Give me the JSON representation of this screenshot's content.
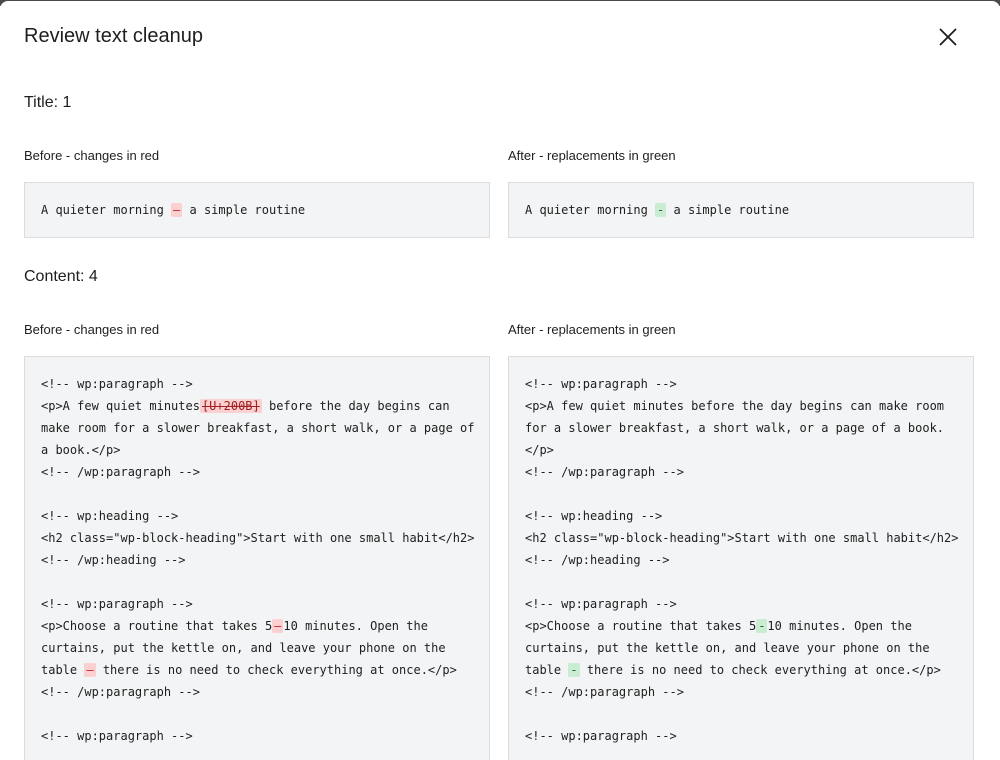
{
  "modal": {
    "title": "Review text cleanup",
    "close_icon": "close-icon"
  },
  "title_section": {
    "heading": "Title: 1",
    "before_label": "Before - changes in red",
    "after_label": "After - replacements in green",
    "before": {
      "pre": "A quieter morning ",
      "mark": "—",
      "post": " a simple routine"
    },
    "after": {
      "pre": "A quieter morning ",
      "mark": "-",
      "post": " a simple routine"
    }
  },
  "content_section": {
    "heading": "Content: 4",
    "before_label": "Before - changes in red",
    "after_label": "After - replacements in green",
    "before_lines": [
      {
        "pre": "<!-- wp:paragraph -->"
      },
      {
        "pre": "<p>A few quiet minutes",
        "mark": "[U+200B]",
        "strike": true,
        "post": " before the day begins can"
      },
      {
        "pre": "make room for a slower breakfast, a short walk, or a page of"
      },
      {
        "pre": "a book.</p>"
      },
      {
        "pre": "<!-- /wp:paragraph -->"
      },
      {
        "pre": ""
      },
      {
        "pre": "<!-- wp:heading -->"
      },
      {
        "pre": "<h2 class=\"wp-block-heading\">Start with one small habit</h2>"
      },
      {
        "pre": "<!-- /wp:heading -->"
      },
      {
        "pre": ""
      },
      {
        "pre": "<!-- wp:paragraph -->"
      },
      {
        "pre": "<p>Choose a routine that takes 5",
        "mark": "–",
        "post": "10 minutes. Open the"
      },
      {
        "pre": "curtains, put the kettle on, and leave your phone on the"
      },
      {
        "pre": "table ",
        "mark": "—",
        "post": " there is no need to check everything at once.</p>"
      },
      {
        "pre": "<!-- /wp:paragraph -->"
      },
      {
        "pre": ""
      },
      {
        "pre": "<!-- wp:paragraph -->"
      }
    ],
    "after_lines": [
      {
        "pre": "<!-- wp:paragraph -->"
      },
      {
        "pre": "<p>A few quiet minutes before the day begins can make room"
      },
      {
        "pre": "for a slower breakfast, a short walk, or a page of a book."
      },
      {
        "pre": "</p>"
      },
      {
        "pre": "<!-- /wp:paragraph -->"
      },
      {
        "pre": ""
      },
      {
        "pre": "<!-- wp:heading -->"
      },
      {
        "pre": "<h2 class=\"wp-block-heading\">Start with one small habit</h2>"
      },
      {
        "pre": "<!-- /wp:heading -->"
      },
      {
        "pre": ""
      },
      {
        "pre": "<!-- wp:paragraph -->"
      },
      {
        "pre": "<p>Choose a routine that takes 5",
        "mark": "-",
        "post": "10 minutes. Open the"
      },
      {
        "pre": "curtains, put the kettle on, and leave your phone on the"
      },
      {
        "pre": "table ",
        "mark": "-",
        "post": " there is no need to check everything at once.</p>"
      },
      {
        "pre": "<!-- /wp:paragraph -->"
      },
      {
        "pre": ""
      },
      {
        "pre": "<!-- wp:paragraph -->"
      }
    ]
  },
  "colors": {
    "removed_bg": "#fbd0d0",
    "removed_text": "#c0292b",
    "added_bg": "#c9ecd2",
    "added_text": "#1e6b35",
    "code_bg": "#f3f4f5"
  }
}
